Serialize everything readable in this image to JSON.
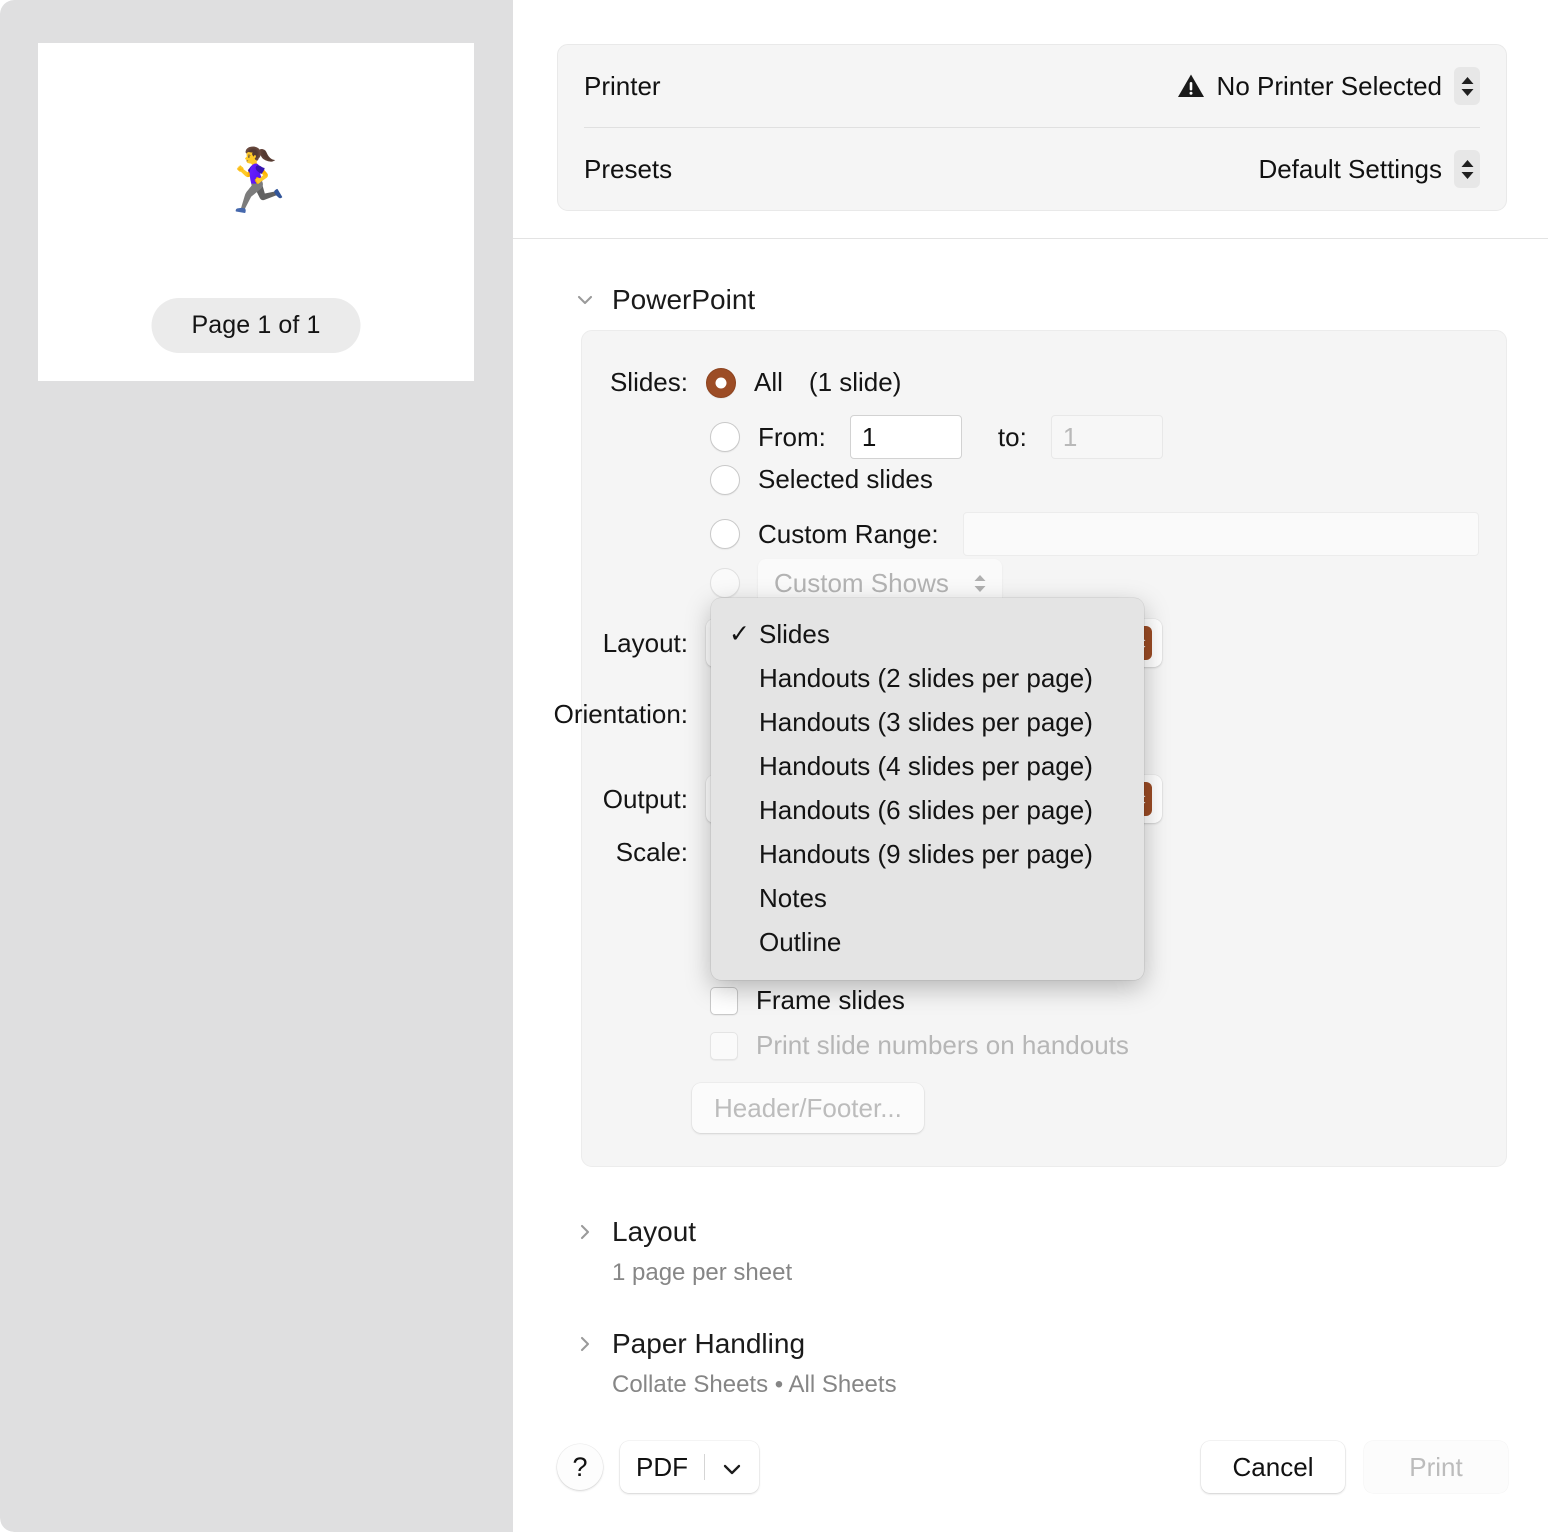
{
  "preview": {
    "artwork_glyph": "🏃‍♀️",
    "artwork_name": "woman-running-emoji",
    "page_indicator": "Page 1 of 1"
  },
  "printer_card": {
    "printer": {
      "label": "Printer",
      "value": "No Printer Selected",
      "warning_icon": "warning-triangle-icon"
    },
    "presets": {
      "label": "Presets",
      "value": "Default Settings"
    }
  },
  "powerpoint": {
    "section_title": "PowerPoint",
    "slides_label": "Slides:",
    "options": {
      "all_label": "All",
      "all_count": "(1 slide)",
      "from_label": "From:",
      "from_value": "1",
      "to_label": "to:",
      "to_value": "1",
      "selected_slides_label": "Selected slides",
      "custom_range_label": "Custom Range:",
      "custom_range_value": "",
      "custom_shows_label": "Custom Shows"
    },
    "fields": {
      "layout_label": "Layout:",
      "layout_value": "Slides",
      "orientation_label": "Orientation:",
      "output_label": "Output:",
      "scale_label": "Scale:"
    },
    "checkboxes": {
      "frame_slides": "Frame slides",
      "print_slide_numbers": "Print slide numbers on handouts"
    },
    "header_footer_button": "Header/Footer..."
  },
  "layout_menu": {
    "checked_index": 0,
    "items": [
      "Slides",
      "Handouts (2 slides per page)",
      "Handouts (3 slides per page)",
      "Handouts (4 slides per page)",
      "Handouts (6 slides per page)",
      "Handouts (9 slides per page)",
      "Notes",
      "Outline"
    ]
  },
  "sections": {
    "layout": {
      "title": "Layout",
      "summary": "1 page per sheet"
    },
    "paper_handling": {
      "title": "Paper Handling",
      "summary": "Collate Sheets • All Sheets"
    }
  },
  "bottom_bar": {
    "help_label": "?",
    "pdf_label": "PDF",
    "cancel_label": "Cancel",
    "print_label": "Print"
  },
  "colors": {
    "accent": "#9c4c25",
    "sidebar_bg": "#dfdfe0",
    "panel_bg": "#f5f5f5",
    "menu_bg": "#e4e4e4"
  }
}
